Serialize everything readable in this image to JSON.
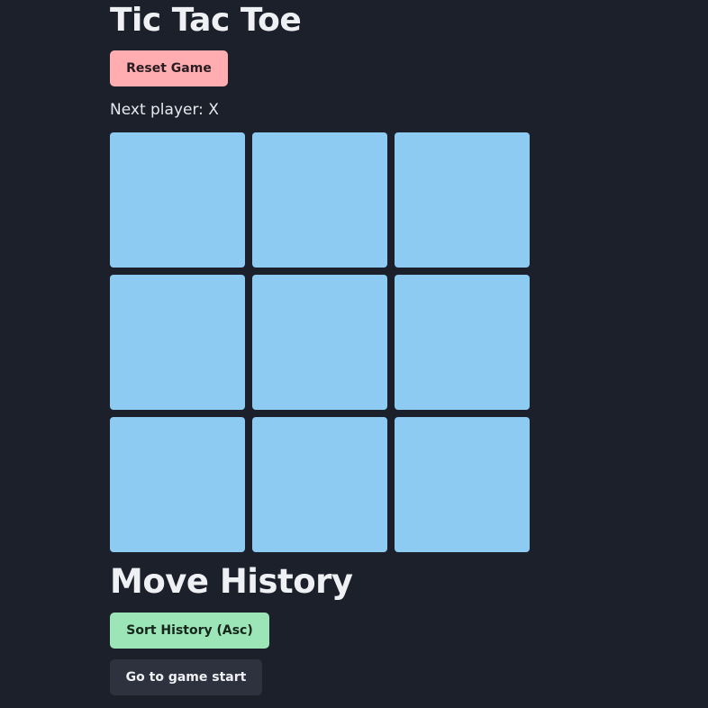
{
  "game": {
    "title": "Tic Tac Toe",
    "reset_label": "Reset Game",
    "status": "Next player: X",
    "squares": [
      "",
      "",
      "",
      "",
      "",
      "",
      "",
      "",
      ""
    ]
  },
  "history": {
    "title": "Move History",
    "sort_label": "Sort History (Asc)",
    "moves": [
      {
        "label": "Go to game start"
      }
    ]
  },
  "colors": {
    "background": "#1c202b",
    "square": "#8ecbf3",
    "reset_button": "#ffadb0",
    "sort_button": "#9be5b6",
    "move_button": "#2d323e"
  }
}
